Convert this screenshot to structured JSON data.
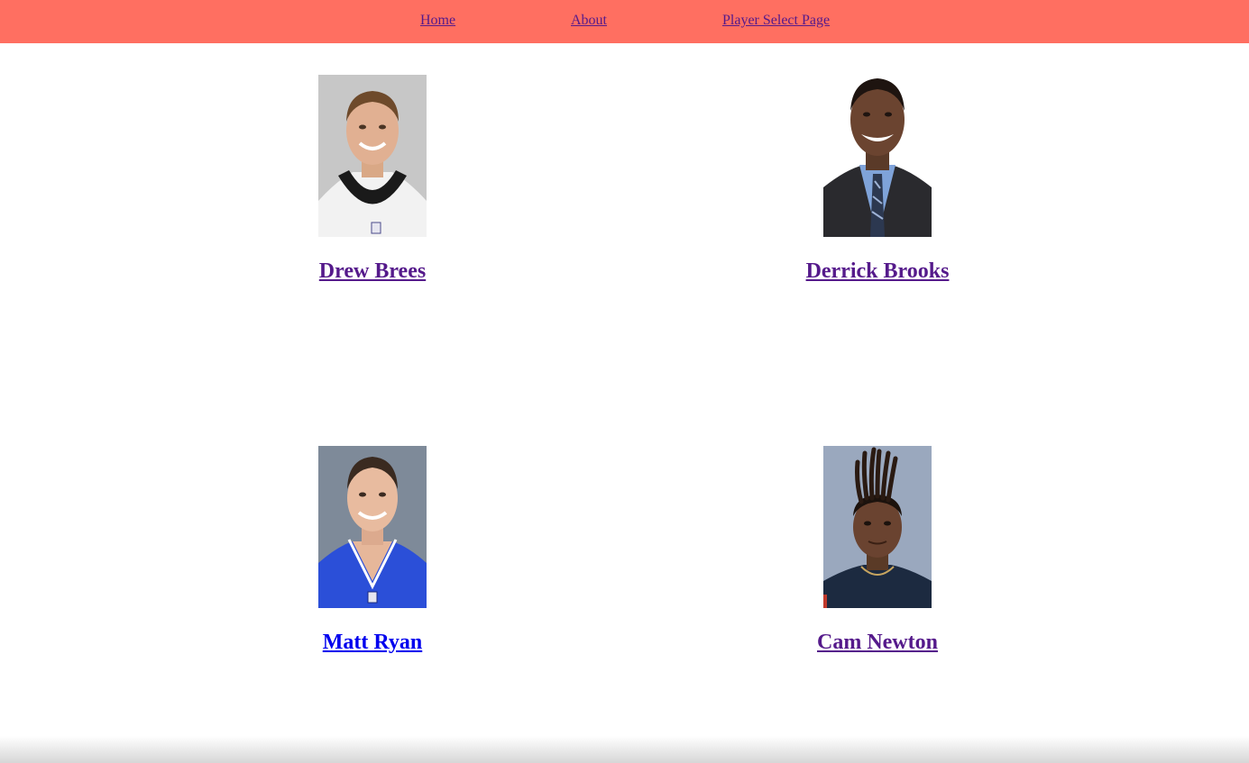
{
  "nav": {
    "home": "Home",
    "about": "About",
    "player_select": "Player Select Page"
  },
  "players": [
    {
      "name": "Drew Brees"
    },
    {
      "name": "Derrick Brooks"
    },
    {
      "name": "Matt Ryan"
    },
    {
      "name": "Cam Newton"
    }
  ],
  "colors": {
    "nav_background": "#ff6f61",
    "visited_link": "#551a8b",
    "unvisited_link": "#0000ee"
  }
}
